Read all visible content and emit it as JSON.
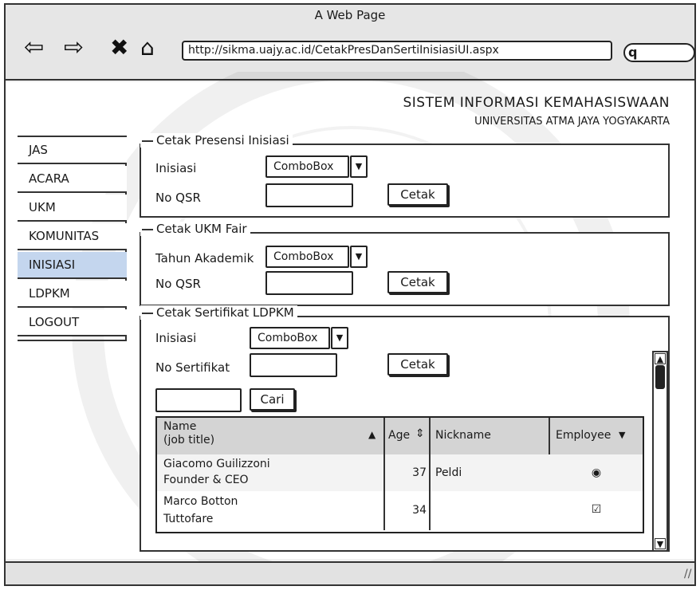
{
  "window": {
    "title": "A Web Page",
    "url": "http://sikma.uajy.ac.id/CetakPresDanSertiInisiasiUI.aspx",
    "search_glyph": "q",
    "icons": [
      "back-arrow-icon",
      "forward-arrow-icon",
      "close-icon",
      "home-icon"
    ]
  },
  "header": {
    "title": "SISTEM INFORMASI KEMAHASISWAAN",
    "subtitle": "UNIVERSITAS ATMA JAYA YOGYAKARTA"
  },
  "sidebar": {
    "items": [
      {
        "label": "JAS"
      },
      {
        "label": "ACARA"
      },
      {
        "label": "UKM"
      },
      {
        "label": "KOMUNITAS"
      },
      {
        "label": "INISIASI",
        "active": true
      },
      {
        "label": "LDPKM"
      },
      {
        "label": "LOGOUT"
      }
    ]
  },
  "presensi": {
    "legend": "Cetak Presensi Inisiasi",
    "inisiasi_label": "Inisiasi",
    "combo_value": "ComboBox",
    "qsr_label": "No QSR",
    "qsr_value": "",
    "button": "Cetak"
  },
  "ukm": {
    "legend": "Cetak UKM Fair",
    "tahun_label": "Tahun Akademik",
    "combo_value": "ComboBox",
    "qsr_label": "No QSR",
    "qsr_value": "",
    "button": "Cetak"
  },
  "sertifikat": {
    "legend": "Cetak Sertifikat LDPKM",
    "inisiasi_label": "Inisiasi",
    "combo_value": "ComboBox",
    "no_label": "No Sertifikat",
    "no_value": "",
    "button": "Cetak",
    "search_value": "",
    "search_button": "Cari",
    "table": {
      "columns": [
        {
          "label": "Name\n(job title)",
          "sort": "▲"
        },
        {
          "label": "Age",
          "sort": "⇕"
        },
        {
          "label": "Nickname",
          "sort": ""
        },
        {
          "label": "Employee",
          "sort": "▼"
        }
      ],
      "rows": [
        {
          "name": "Giacomo Guilizzoni",
          "title": "Founder & CEO",
          "age": "37",
          "nickname": "Peldi",
          "employee": "◉"
        },
        {
          "name": "Marco Botton",
          "title": "Tuttofare",
          "age": "34",
          "nickname": "",
          "employee": "☑"
        }
      ]
    }
  },
  "colors": {
    "active_item": "#c4d6ee",
    "chrome": "#e6e6e6",
    "table_header": "#d4d4d4",
    "ink": "#222222"
  }
}
